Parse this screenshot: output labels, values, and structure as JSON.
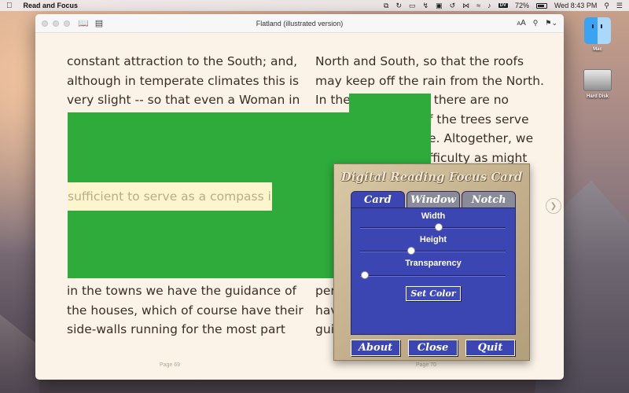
{
  "menubar": {
    "apple": "",
    "app_name": "Read and Focus",
    "battery_pct": "72%",
    "clock": "Wed 8:43 PM",
    "dv_label": "DV",
    "icons": [
      "dropbox-icon",
      "sync-icon",
      "airplay-icon",
      "pin-icon",
      "lock-icon",
      "time-machine-icon",
      "bluetooth-icon",
      "wifi-icon",
      "volume-icon",
      "dv-icon",
      "battery-icon",
      "search-icon",
      "notification-icon"
    ]
  },
  "desktop": {
    "mac_label": "Mac",
    "hd_label": "Hard Disk"
  },
  "window": {
    "title": "Flatland (illustrated version)",
    "font_size_label_small": "A",
    "font_size_label_big": "A"
  },
  "left_page": {
    "lines": [
      "constant attraction to the South; and,",
      "although in temperate climates this is",
      "very slight -- so that even a Woman in"
    ],
    "lines_bottom": [
      "in the towns we have the guidance of",
      "the houses, which of course have their",
      "side-walls running for the most part"
    ],
    "page_label": "Page 69"
  },
  "right_page": {
    "lines": [
      "North and South, so that the roofs",
      "may keep off the rain from the North."
    ],
    "partial": {
      "line3_pre": "In the",
      "line3_post": "there are no",
      "line4_post": "f the trees serve",
      "line5_post": "e. Altogether, we",
      "line6_post": "fficulty as might",
      "line_b1": "per",
      "line_b2": "hav",
      "line_b3": "gui"
    },
    "page_label": "Page 70"
  },
  "focus": {
    "highlight_text": "sufficient to serve as a compass in",
    "green_color": "#2eab3b"
  },
  "focus_card": {
    "title": "Digital Reading Focus Card",
    "tabs": [
      {
        "label": "Card",
        "active": true
      },
      {
        "label": "Window",
        "active": false
      },
      {
        "label": "Notch",
        "active": false
      }
    ],
    "controls": {
      "width_label": "Width",
      "height_label": "Height",
      "transparency_label": "Transparency",
      "width_value": 0.54,
      "height_value": 0.35,
      "transparency_value": 0.03
    },
    "set_color_label": "Set Color",
    "buttons": {
      "about": "About",
      "close": "Close",
      "quit": "Quit"
    },
    "accent_color": "#3c46b3"
  }
}
